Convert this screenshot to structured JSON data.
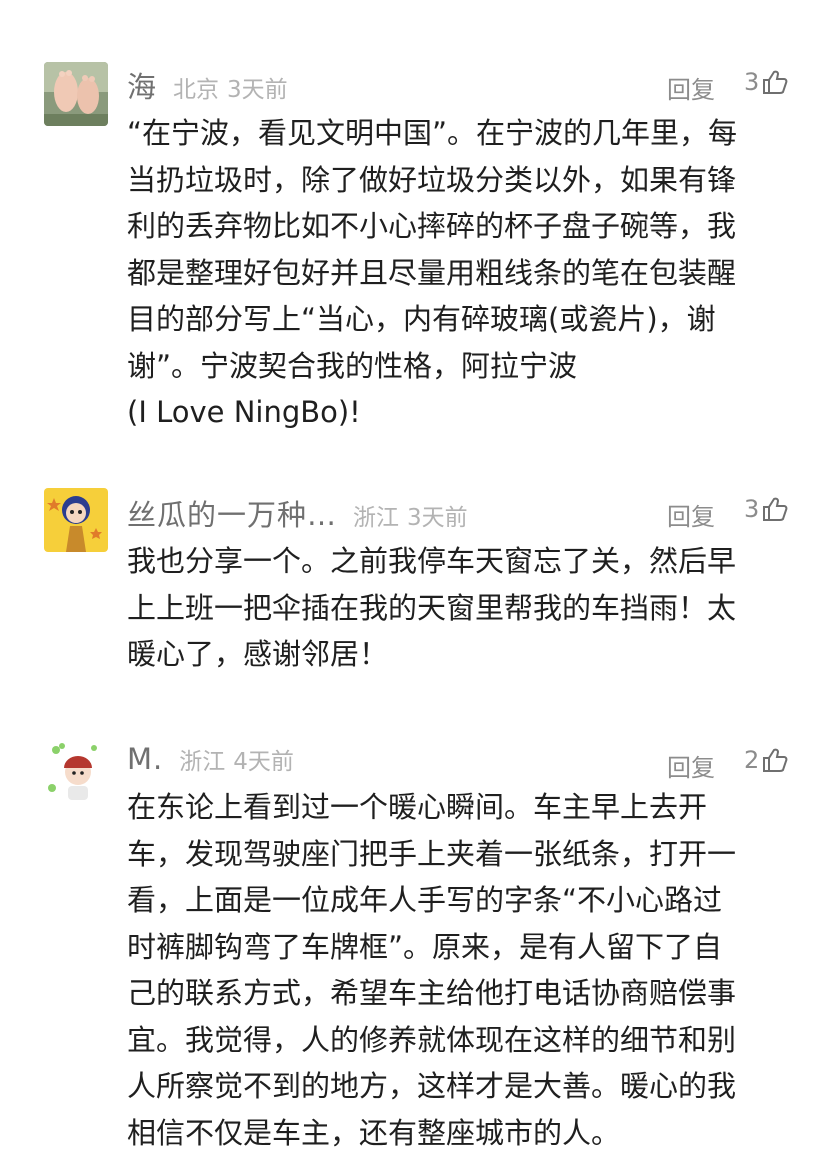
{
  "comments": [
    {
      "author": "海",
      "location": "北京",
      "time": "3天前",
      "reply_label": "回复",
      "likes": "3",
      "avatar_icon": "baby-feet-photo",
      "text": "“在宁波，看见文明中国”。在宁波的几年里，每\n当扔垃圾时，除了做好垃圾分类以外，如果有锋\n利的丢弃物比如不小心摔碎的杯子盘子碗等，我\n都是整理好包好并且尽量用粗线条的笔在包装醒\n目的部分写上“当心，内有碎玻璃(或瓷片)，谢\n谢”。宁波契合我的性格，阿拉宁波\n(I Love NingBo)!"
    },
    {
      "author": "丝瓜的一万种…",
      "location": "浙江",
      "time": "3天前",
      "reply_label": "回复",
      "likes": "3",
      "avatar_icon": "cartoon-girl-avatar",
      "text": "我也分享一个。之前我停车天窗忘了关，然后早\n上上班一把伞插在我的天窗里帮我的车挡雨！太\n暖心了，感谢邻居！"
    },
    {
      "author": "M.",
      "location": "浙江",
      "time": "4天前",
      "reply_label": "回复",
      "likes": "2",
      "avatar_icon": "cartoon-character-avatar",
      "text": "在东论上看到过一个暖心瞬间。车主早上去开\n车，发现驾驶座门把手上夹着一张纸条，打开一\n看，上面是一位成年人手写的字条“不小心路过\n时裤脚钩弯了车牌框”。原来，是有人留下了自\n己的联系方式，希望车主给他打电话协商赔偿事\n宜。我觉得，人的修养就体现在这样的细节和别\n人所察觉不到的地方，这样才是大善。暖心的我\n相信不仅是车主，还有整座城市的人。"
    }
  ]
}
